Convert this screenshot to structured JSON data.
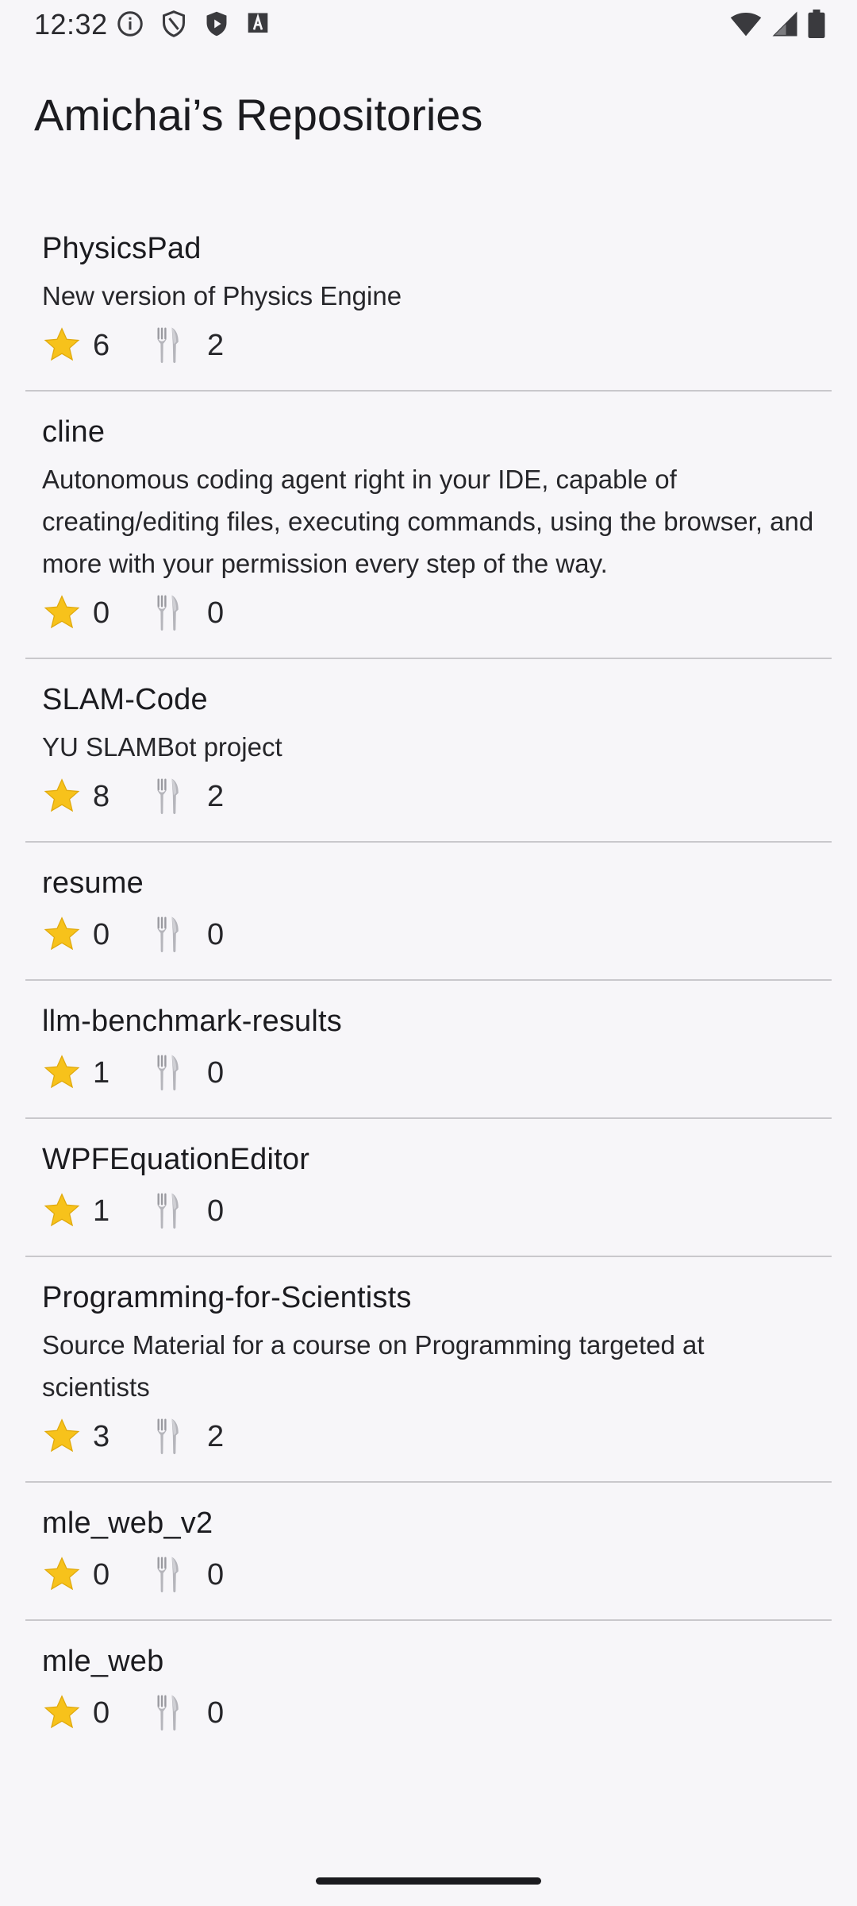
{
  "status_bar": {
    "time": "12:32",
    "icons_left": [
      "info-icon",
      "shield-outline-icon",
      "shield-play-icon",
      "font-a-icon"
    ],
    "icons_right": [
      "wifi-icon",
      "cell-signal-icon",
      "battery-icon"
    ]
  },
  "page": {
    "title": "Amichai’s Repositories"
  },
  "repos": [
    {
      "name": "PhysicsPad",
      "description": "New version of Physics Engine",
      "stars": "6",
      "forks": "2"
    },
    {
      "name": "cline",
      "description": "Autonomous coding agent right in your IDE, capable of creating/editing files, executing commands, using the browser, and more with your permission every step of the way.",
      "stars": "0",
      "forks": "0"
    },
    {
      "name": "SLAM-Code",
      "description": "YU SLAMBot project",
      "stars": "8",
      "forks": "2"
    },
    {
      "name": "resume",
      "description": "",
      "stars": "0",
      "forks": "0"
    },
    {
      "name": "llm-benchmark-results",
      "description": "",
      "stars": "1",
      "forks": "0"
    },
    {
      "name": "WPFEquationEditor",
      "description": "",
      "stars": "1",
      "forks": "0"
    },
    {
      "name": "Programming-for-Scientists",
      "description": "Source Material for a course on Programming targeted at scientists",
      "stars": "3",
      "forks": "2"
    },
    {
      "name": "mle_web_v2",
      "description": "",
      "stars": "0",
      "forks": "0"
    },
    {
      "name": "mle_web",
      "description": "",
      "stars": "0",
      "forks": "0"
    }
  ],
  "icons": {
    "star": "star-icon",
    "fork": "fork-knife-icon"
  },
  "colors": {
    "background": "#f7f6f9",
    "divider": "#c9c8cc",
    "star": "#f7c21b",
    "text": "#1b1b1f"
  }
}
